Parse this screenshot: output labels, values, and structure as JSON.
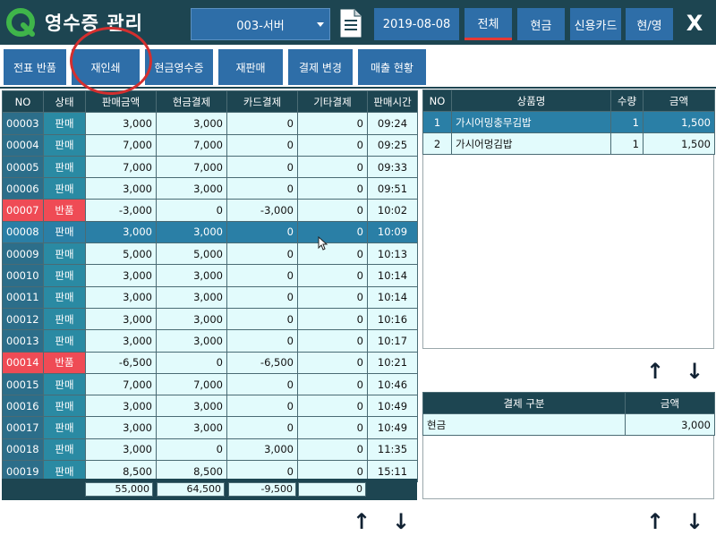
{
  "header": {
    "title": "영수증 관리",
    "store": "003-서버",
    "date": "2019-08-08",
    "filters": [
      "전체",
      "현금",
      "신용카드",
      "현/영"
    ],
    "active_filter": "전체",
    "close_label": "X"
  },
  "toolbar": [
    "전표 반품",
    "재인쇄",
    "현금영수증",
    "재판매",
    "결제 변경",
    "매출 현황"
  ],
  "receipts": {
    "columns": [
      "NO",
      "상태",
      "판매금액",
      "현금결제",
      "카드결제",
      "기타결제",
      "판매시간"
    ],
    "rows": [
      [
        "00003",
        "판매",
        "3,000",
        "3,000",
        "0",
        "0",
        "09:24"
      ],
      [
        "00004",
        "판매",
        "7,000",
        "7,000",
        "0",
        "0",
        "09:25"
      ],
      [
        "00005",
        "판매",
        "7,000",
        "7,000",
        "0",
        "0",
        "09:33"
      ],
      [
        "00006",
        "판매",
        "3,000",
        "3,000",
        "0",
        "0",
        "09:51"
      ],
      [
        "00007",
        "반품",
        "-3,000",
        "0",
        "-3,000",
        "0",
        "10:02"
      ],
      [
        "00008",
        "판매",
        "3,000",
        "3,000",
        "0",
        "0",
        "10:09"
      ],
      [
        "00009",
        "판매",
        "5,000",
        "5,000",
        "0",
        "0",
        "10:13"
      ],
      [
        "00010",
        "판매",
        "3,000",
        "3,000",
        "0",
        "0",
        "10:14"
      ],
      [
        "00011",
        "판매",
        "3,000",
        "3,000",
        "0",
        "0",
        "10:14"
      ],
      [
        "00012",
        "판매",
        "3,000",
        "3,000",
        "0",
        "0",
        "10:16"
      ],
      [
        "00013",
        "판매",
        "3,000",
        "3,000",
        "0",
        "0",
        "10:17"
      ],
      [
        "00014",
        "반품",
        "-6,500",
        "0",
        "-6,500",
        "0",
        "10:21"
      ],
      [
        "00015",
        "판매",
        "7,000",
        "7,000",
        "0",
        "0",
        "10:46"
      ],
      [
        "00016",
        "판매",
        "3,000",
        "3,000",
        "0",
        "0",
        "10:49"
      ],
      [
        "00017",
        "판매",
        "3,000",
        "3,000",
        "0",
        "0",
        "10:49"
      ],
      [
        "00018",
        "판매",
        "3,000",
        "0",
        "3,000",
        "0",
        "11:35"
      ],
      [
        "00019",
        "판매",
        "8,500",
        "8,500",
        "0",
        "0",
        "15:11"
      ]
    ],
    "selected_no": "00008",
    "totals": [
      "55,000",
      "64,500",
      "-9,500",
      "0"
    ]
  },
  "items": {
    "columns": [
      "NO",
      "상품명",
      "수량",
      "금액"
    ],
    "rows": [
      [
        "1",
        "가시어밍충무김밥",
        "1",
        "1,500"
      ],
      [
        "2",
        "가시어멍김밥",
        "1",
        "1,500"
      ]
    ],
    "selected_index": 0
  },
  "payments": {
    "columns": [
      "결제 구분",
      "금액"
    ],
    "rows": [
      [
        "현금",
        "3,000"
      ]
    ]
  },
  "arrows": {
    "up": "↑",
    "down": "↓"
  },
  "colors": {
    "header_bg": "#1d4551",
    "button_blue": "#2e6ea8",
    "row_bg": "#e2fbfc",
    "selected_row": "#2a7fa6",
    "return_red": "#ef4b55",
    "active_underline": "#e53935"
  },
  "icons": {
    "logo": "q-logo-icon",
    "document": "document-icon",
    "close": "close-icon"
  }
}
